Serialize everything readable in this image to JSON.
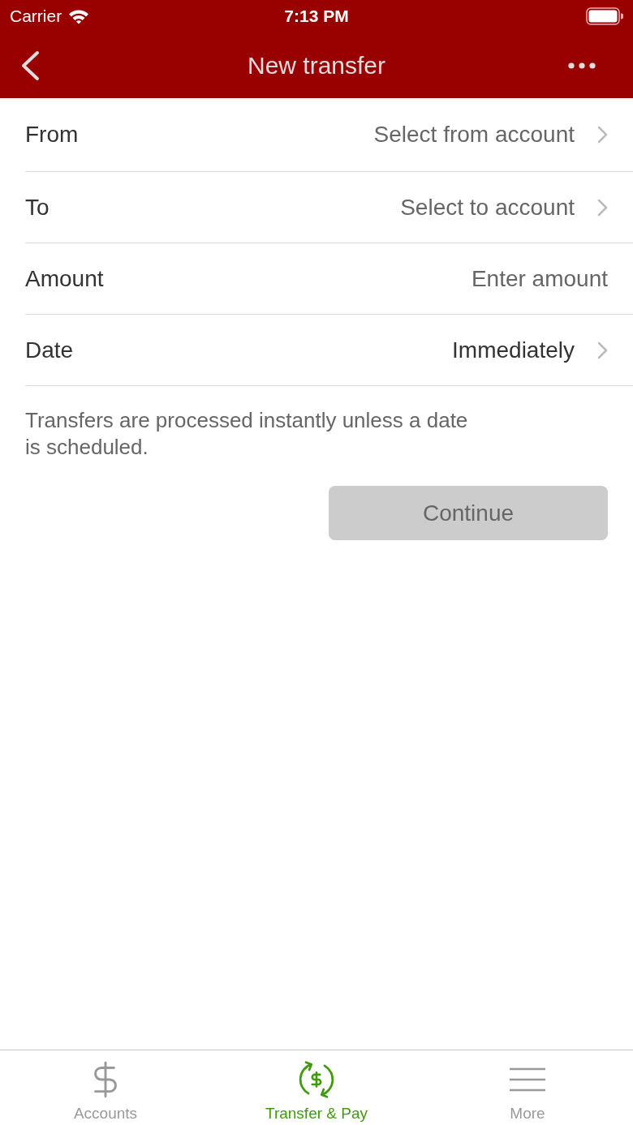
{
  "status_bar": {
    "carrier": "Carrier",
    "time": "7:13 PM"
  },
  "nav_bar": {
    "title": "New transfer"
  },
  "form_rows": [
    {
      "kind": "select",
      "label": "From",
      "placeholder": "Select from account"
    },
    {
      "kind": "select",
      "label": "To",
      "placeholder": "Select to account"
    },
    {
      "kind": "input",
      "label": "Amount",
      "placeholder": "Enter amount"
    },
    {
      "kind": "select",
      "label": "Date",
      "value": "Immediately"
    }
  ],
  "note": "Transfers are processed instantly unless a date is scheduled.",
  "continue_button": {
    "label": "Continue",
    "disabled": true
  },
  "tab_bar": [
    {
      "label": "Accounts",
      "selected": false
    },
    {
      "label": "Transfer & Pay",
      "selected": true
    },
    {
      "label": "More",
      "selected": false
    }
  ]
}
